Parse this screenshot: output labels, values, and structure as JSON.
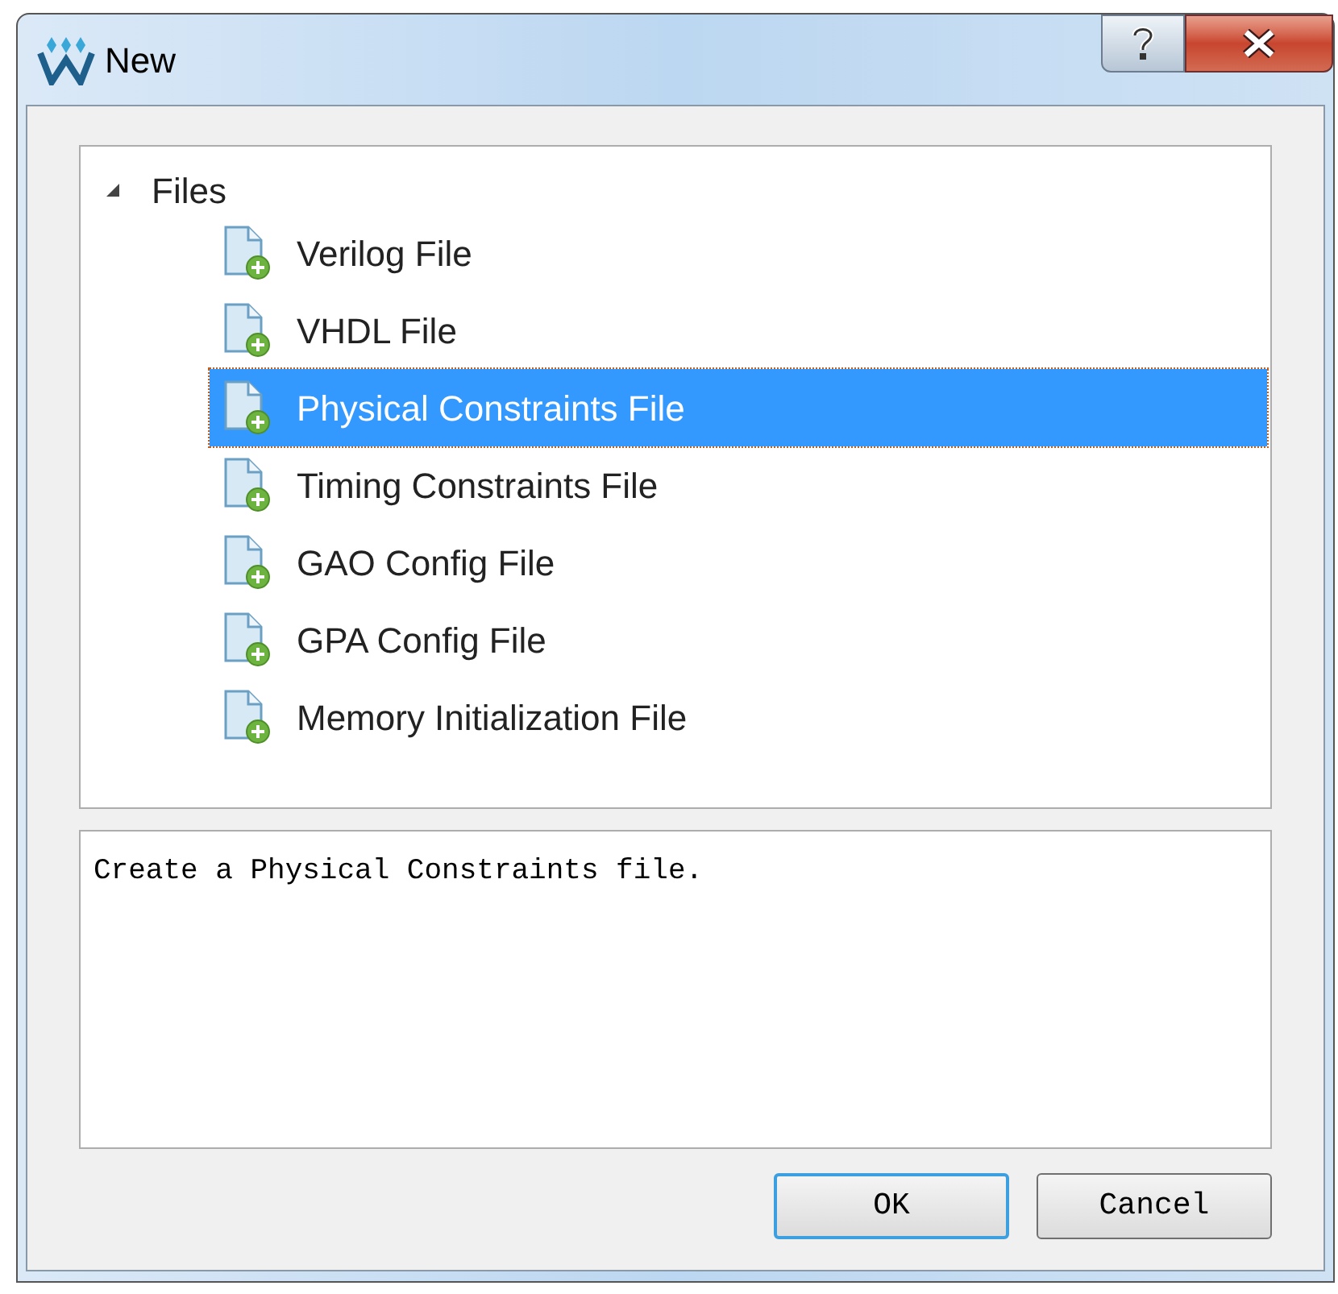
{
  "window": {
    "title": "New"
  },
  "tree": {
    "label": "Files",
    "expanded": true,
    "children": [
      {
        "label": "Verilog File",
        "selected": false
      },
      {
        "label": "VHDL File",
        "selected": false
      },
      {
        "label": "Physical Constraints File",
        "selected": true
      },
      {
        "label": "Timing Constraints File",
        "selected": false
      },
      {
        "label": "GAO Config File",
        "selected": false
      },
      {
        "label": "GPA Config File",
        "selected": false
      },
      {
        "label": "Memory Initialization File",
        "selected": false
      }
    ]
  },
  "description": "Create a Physical Constraints file.",
  "buttons": [
    {
      "label": "OK",
      "default": true
    },
    {
      "label": "Cancel",
      "default": false
    }
  ]
}
